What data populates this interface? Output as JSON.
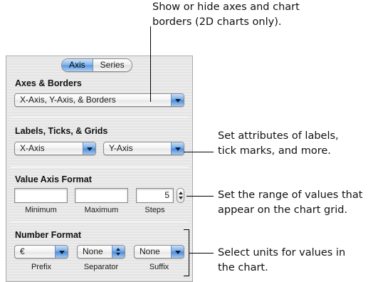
{
  "callouts": {
    "axes_borders_line1": "Show or hide axes and chart",
    "axes_borders_line2": "borders (2D charts only).",
    "labels_line1": "Set attributes of labels,",
    "labels_line2": "tick marks, and more.",
    "range_line1": "Set the range of values that",
    "range_line2": "appear on the chart grid.",
    "units_line1": "Select units for values in",
    "units_line2": "the chart."
  },
  "panel": {
    "tabs": [
      {
        "label": "Axis",
        "selected": true
      },
      {
        "label": "Series",
        "selected": false
      }
    ],
    "axes_borders": {
      "title": "Axes & Borders",
      "value": "X-Axis, Y-Axis, & Borders"
    },
    "labels_ticks_grids": {
      "title": "Labels, Ticks, & Grids",
      "x_axis": "X-Axis",
      "y_axis": "Y-Axis"
    },
    "value_axis_format": {
      "title": "Value Axis Format",
      "minimum_value": "",
      "maximum_value": "",
      "steps_value": "5",
      "minimum_label": "Minimum",
      "maximum_label": "Maximum",
      "steps_label": "Steps"
    },
    "number_format": {
      "title": "Number Format",
      "prefix_value": "€",
      "separator_value": "None",
      "suffix_value": "None",
      "prefix_label": "Prefix",
      "separator_label": "Separator",
      "suffix_label": "Suffix"
    }
  },
  "colors": {
    "panel_background": "#e8e8e8",
    "aqua_accent": "#5b98df",
    "callout_line": "#000000"
  }
}
